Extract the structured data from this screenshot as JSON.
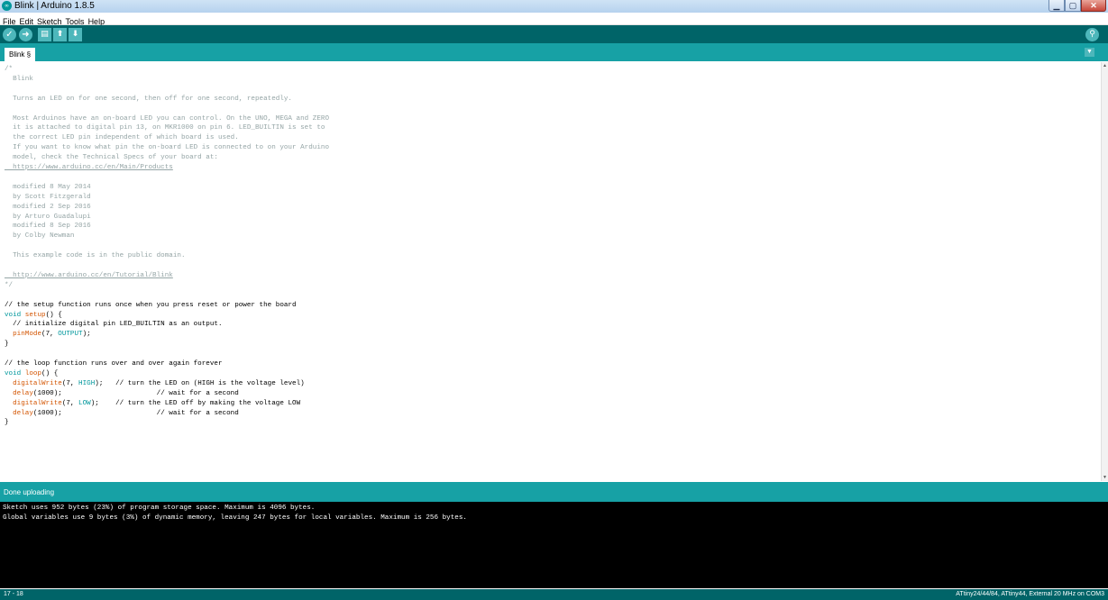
{
  "window": {
    "title": "Blink | Arduino 1.8.5",
    "app_icon": "arduino-icon",
    "controls": [
      "minimize-icon",
      "maximize-icon",
      "close-icon"
    ]
  },
  "menu": [
    "File",
    "Edit",
    "Sketch",
    "Tools",
    "Help"
  ],
  "toolbar": {
    "buttons": [
      "verify-icon",
      "upload-icon",
      "new-icon",
      "open-icon",
      "save-icon"
    ],
    "right_button": "serial-monitor-icon"
  },
  "tabs": [
    {
      "label": "Blink §",
      "active": true
    }
  ],
  "editor": {
    "lines": [
      "/*",
      "  Blink",
      "",
      "  Turns an LED on for one second, then off for one second, repeatedly.",
      "",
      "  Most Arduinos have an on-board LED you can control. On the UNO, MEGA and ZERO",
      "  it is attached to digital pin 13, on MKR1000 on pin 6. LED_BUILTIN is set to",
      "  the correct LED pin independent of which board is used.",
      "  If you want to know what pin the on-board LED is connected to on your Arduino",
      "  model, check the Technical Specs of your board at:",
      "  https://www.arduino.cc/en/Main/Products",
      "",
      "  modified 8 May 2014",
      "  by Scott Fitzgerald",
      "  modified 2 Sep 2016",
      "  by Arturo Guadalupi",
      "  modified 8 Sep 2016",
      "  by Colby Newman",
      "",
      "  This example code is in the public domain.",
      "",
      "  http://www.arduino.cc/en/Tutorial/Blink",
      "*/",
      "",
      "// the setup function runs once when you press reset or power the board",
      "void setup() {",
      "  // initialize digital pin LED_BUILTIN as an output.",
      "  pinMode(7, OUTPUT);",
      "}",
      "",
      "// the loop function runs over and over again forever",
      "void loop() {",
      "  digitalWrite(7, HIGH);   // turn the LED on (HIGH is the voltage level)",
      "  delay(1000);                       // wait for a second",
      "  digitalWrite(7, LOW);    // turn the LED off by making the voltage LOW",
      "  delay(1000);                       // wait for a second",
      "}"
    ],
    "highlighted_line": 18
  },
  "status": {
    "message": "Done uploading"
  },
  "console": [
    "Sketch uses 952 bytes (23%) of program storage space. Maximum is 4096 bytes.",
    "Global variables use 9 bytes (3%) of dynamic memory, leaving 247 bytes for local variables. Maximum is 256 bytes."
  ],
  "footer": {
    "line_range": "17 - 18",
    "board": "ATtiny24/44/84, ATtiny44, External 20 MHz on COM3"
  },
  "colors": {
    "teal_dark": "#006468",
    "teal": "#17a1a5",
    "comment": "#95a5a6",
    "keyword": "#00979c",
    "function": "#d35400",
    "highlight": "#f6c613"
  }
}
